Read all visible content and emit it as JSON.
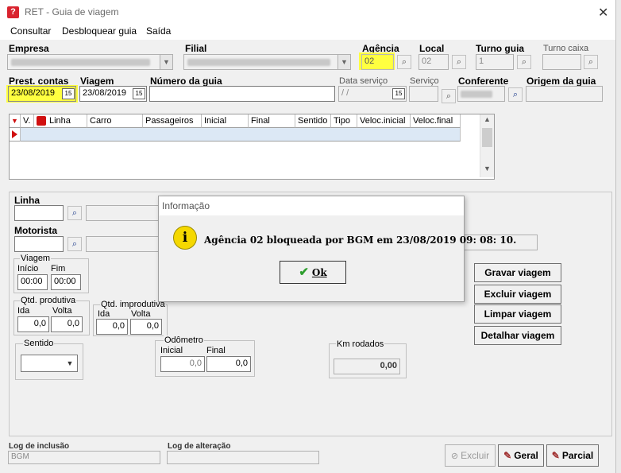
{
  "window": {
    "title": "RET - Guia de viagem",
    "close_glyph": "✕"
  },
  "menu": [
    "Consultar",
    "Desbloquear guia",
    "Saída"
  ],
  "header": {
    "empresa_label": "Empresa",
    "filial_label": "Filial",
    "agencia_label": "Agência",
    "agencia_value": "02",
    "local_label": "Local",
    "local_value": "02",
    "turno_guia_label": "Turno guia",
    "turno_guia_value": "1",
    "turno_caixa_label": "Turno caixa",
    "prest_contas_label": "Prest. contas",
    "prest_contas_value": "23/08/2019",
    "viagem_label": "Viagem",
    "viagem_value": "23/08/2019",
    "numero_guia_label": "Número da guia",
    "data_servico_label": "Data serviço",
    "data_servico_value": " / /",
    "servico_label": "Serviço",
    "conferente_label": "Conferente",
    "origem_guia_label": "Origem da guia"
  },
  "grid": {
    "columns": [
      "V.",
      "Linha",
      "Carro",
      "Passageiros",
      "Inicial",
      "Final",
      "Sentido",
      "Tipo",
      "Veloc.inicial",
      "Veloc.final"
    ]
  },
  "detail": {
    "linha_label": "Linha",
    "motorista_label": "Motorista",
    "viagem_group": "Viagem",
    "inicio_label": "Início",
    "inicio_value": "00:00",
    "fim_label": "Fim",
    "fim_value": "00:00",
    "qtd_produtiva_group": "Qtd. produtiva",
    "qtd_improdutiva_group": "Qtd. improdutiva",
    "ida_label": "Ida",
    "volta_label": "Volta",
    "prod_ida": "0,0",
    "prod_volta": "0,0",
    "improd_ida": "0,0",
    "improd_volta": "0,0",
    "sentido_group": "Sentido",
    "odometro_group": "Odômetro",
    "odo_inicial_label": "Inicial",
    "odo_final_label": "Final",
    "odo_inicial": "0,0",
    "odo_final": "0,0",
    "km_rodados_group": "Km rodados",
    "km_rodados": "0,00"
  },
  "actions": {
    "gravar": "Gravar viagem",
    "excluir_viagem": "Excluir viagem",
    "limpar": "Limpar viagem",
    "detalhar": "Detalhar viagem"
  },
  "footer": {
    "log_inclusao_label": "Log de inclusão",
    "log_inclusao_value": "BGM",
    "log_alteracao_label": "Log de alteração",
    "excluir": "Excluir",
    "geral": "Geral",
    "parcial": "Parcial"
  },
  "dialog": {
    "title": "Informação",
    "message": "Agência 02 bloqueada por BGM em 23/08/2019 09: 08: 10.",
    "ok": "Ok",
    "icon": "info-icon"
  },
  "colors": {
    "highlight": "#ffff40",
    "dialog_icon": "#f5d800",
    "ok_check": "#2e9e2e",
    "grid_selected": "#dce8f5"
  }
}
